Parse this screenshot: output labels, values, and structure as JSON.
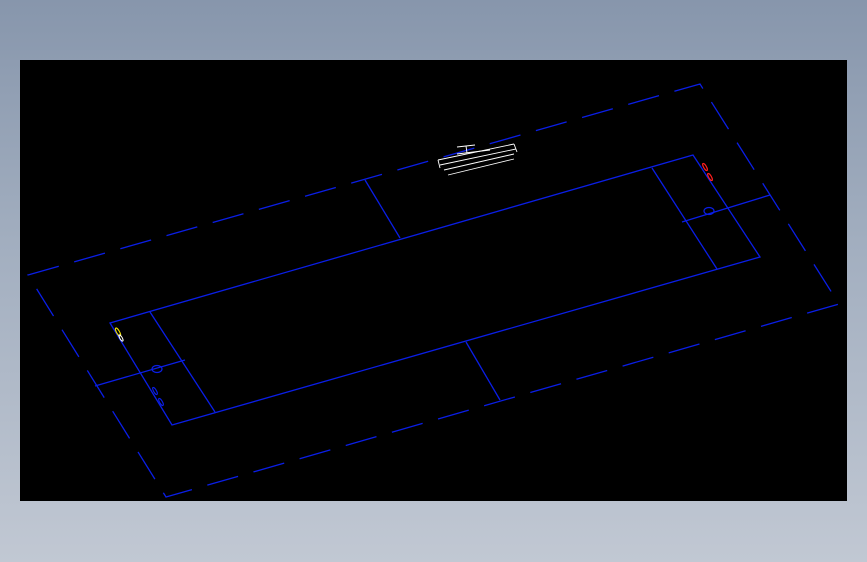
{
  "drawing": {
    "background_color": "#000000",
    "outline_color": "#0a1ee6",
    "annotation_color": "#ffffff",
    "marker_color": "#ff1e1e",
    "highlight_color": "#f0e000",
    "hidden_line_style": "dashed",
    "view": "isometric"
  }
}
